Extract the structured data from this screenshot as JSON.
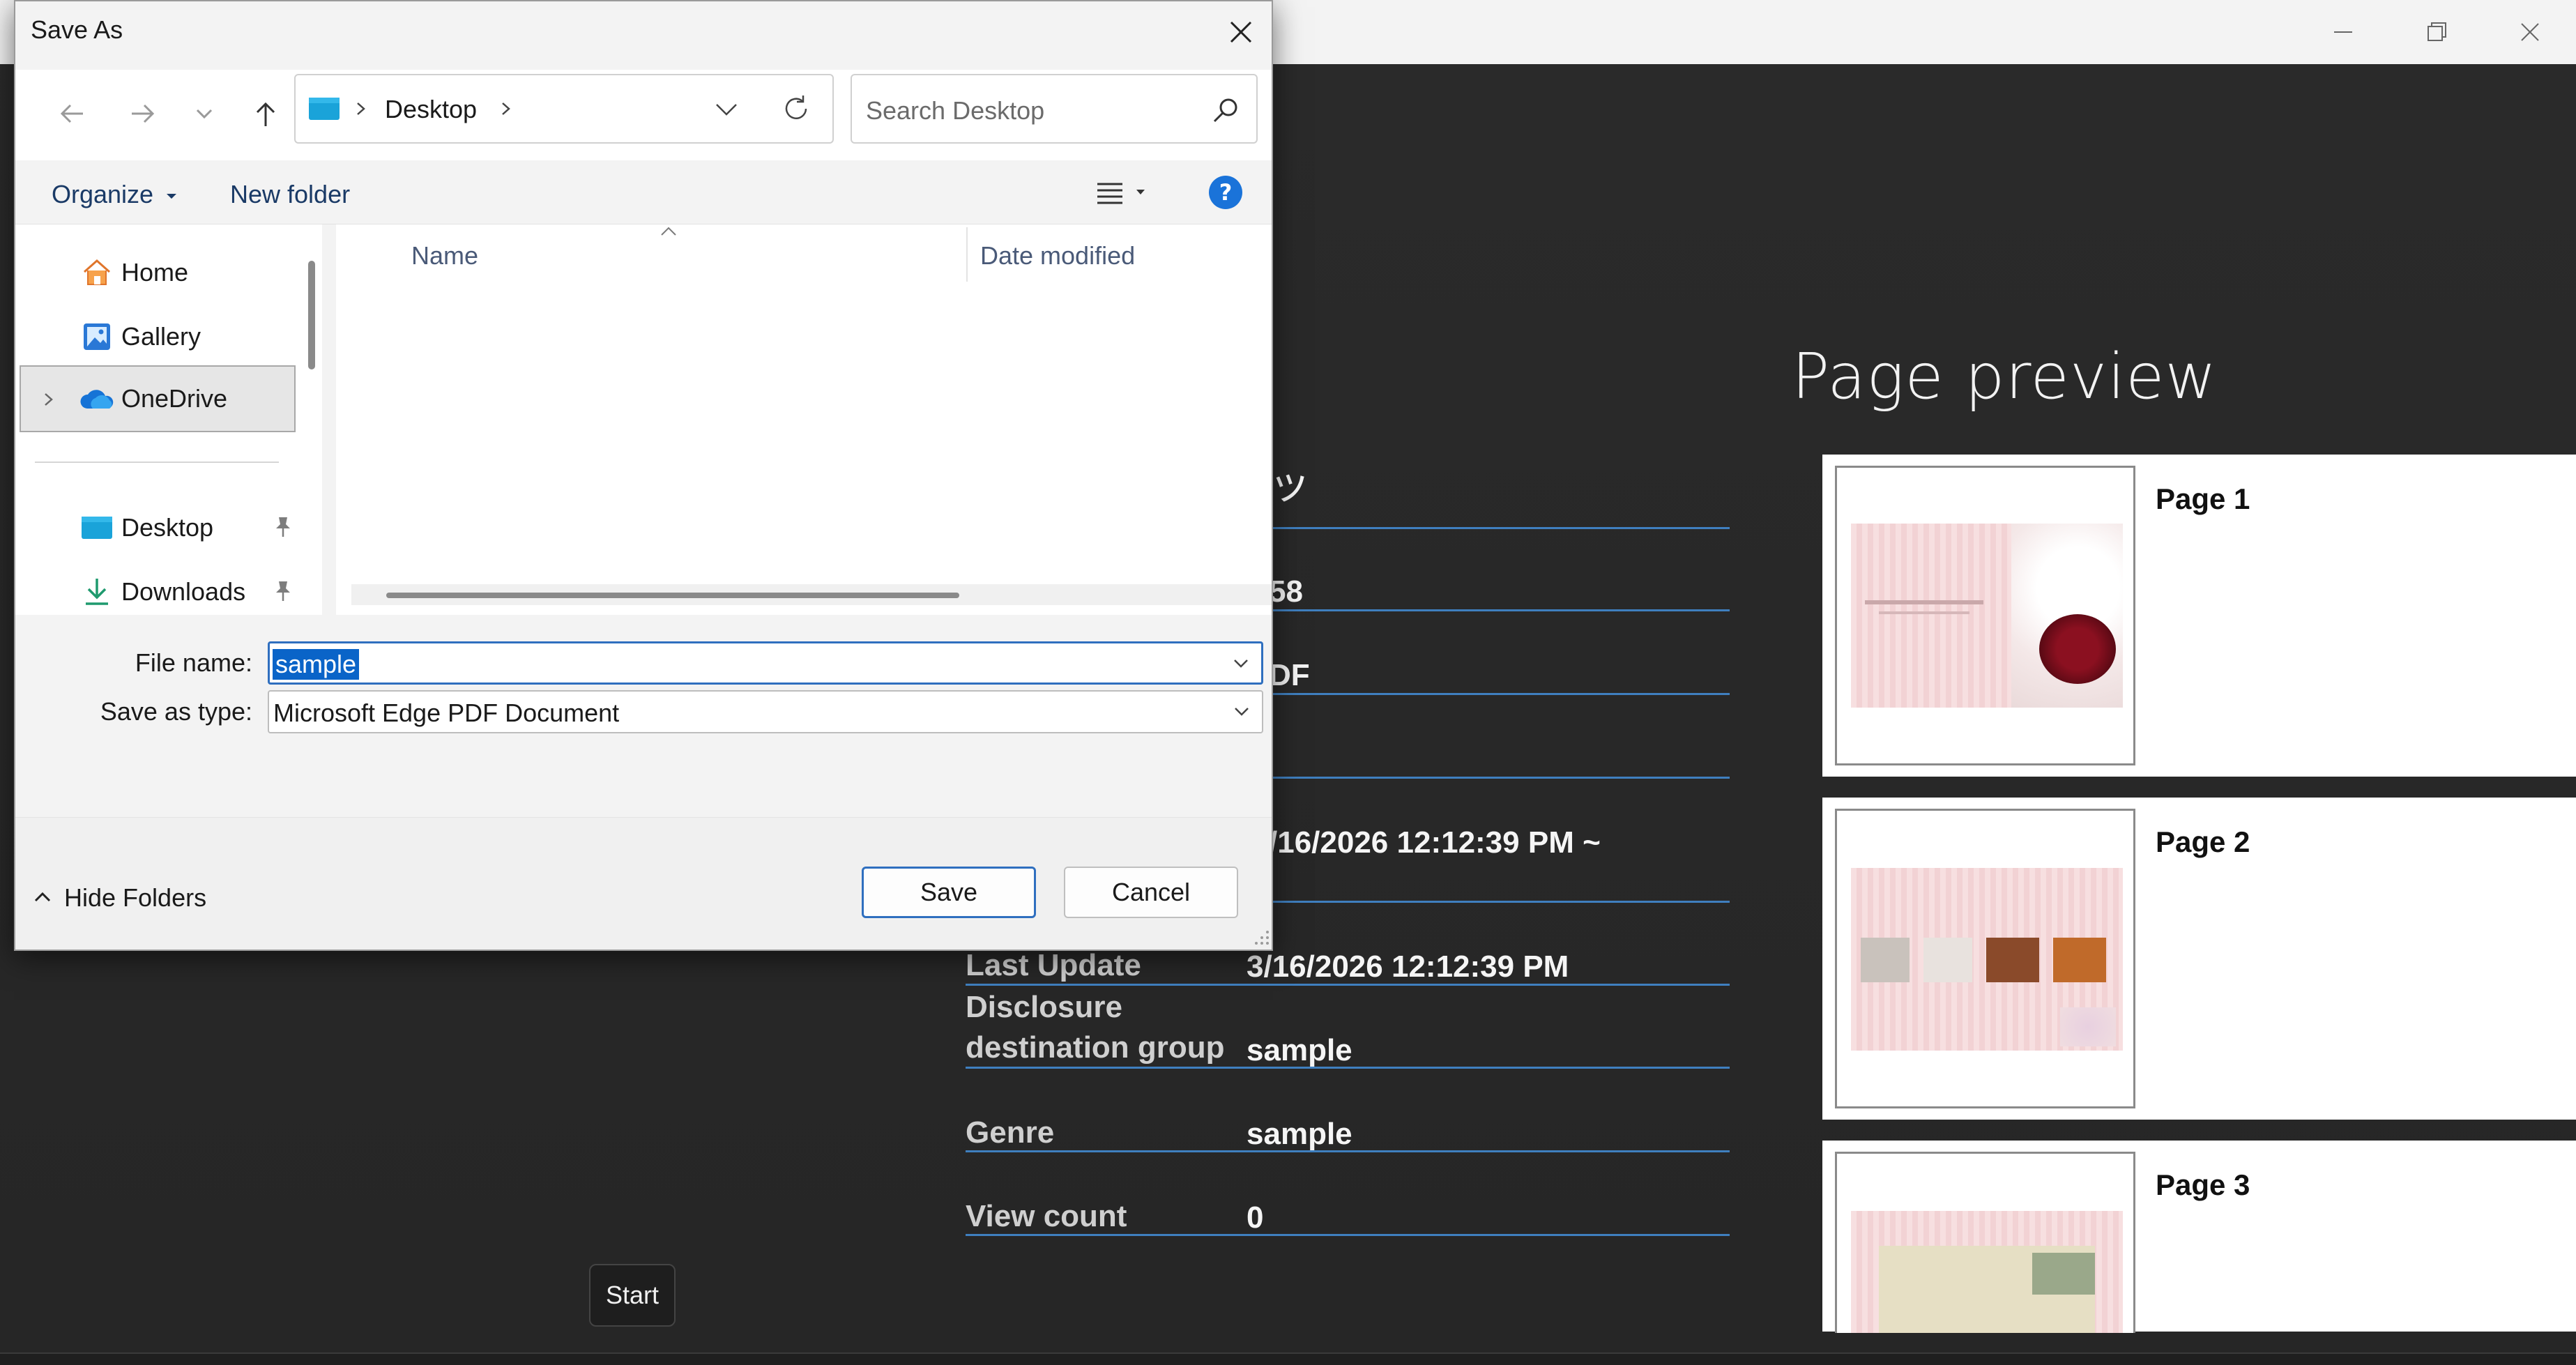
{
  "app": {
    "preview_heading": "Page preview",
    "pages": [
      {
        "label": "Page 1"
      },
      {
        "label": "Page 2"
      },
      {
        "label": "Page 3"
      }
    ],
    "info_partial": {
      "title_fragment": "ッ",
      "row2_fragment": "58",
      "row3_fragment": "DF",
      "period_fragment": "/16/2026 12:12:39 PM ~"
    },
    "info_rows": [
      {
        "label": "Last Update",
        "value": "3/16/2026 12:12:39 PM"
      },
      {
        "label_line1": "Disclosure",
        "label_line2": "destination group",
        "value": "sample"
      },
      {
        "label": "Genre",
        "value": "sample"
      },
      {
        "label": "View count",
        "value": "0"
      }
    ],
    "start_button": "Start"
  },
  "dialog": {
    "title": "Save As",
    "address": {
      "folder": "Desktop"
    },
    "search_placeholder": "Search Desktop",
    "toolbar": {
      "organize": "Organize",
      "new_folder": "New folder"
    },
    "nav_items": [
      {
        "label": "Home",
        "icon": "home-icon"
      },
      {
        "label": "Gallery",
        "icon": "gallery-icon"
      },
      {
        "label": "OneDrive",
        "icon": "onedrive-icon"
      },
      {
        "label": "Desktop",
        "icon": "desktop-icon"
      },
      {
        "label": "Downloads",
        "icon": "downloads-icon"
      }
    ],
    "columns": {
      "name": "Name",
      "date_modified": "Date modified"
    },
    "file_name_label": "File name:",
    "file_name_value": "sample",
    "save_type_label": "Save as type:",
    "save_type_value": "Microsoft Edge PDF Document",
    "hide_folders": "Hide Folders",
    "save_button": "Save",
    "cancel_button": "Cancel",
    "colors": {
      "accent": "#2f6fbf",
      "selection": "#0a64c8"
    }
  }
}
